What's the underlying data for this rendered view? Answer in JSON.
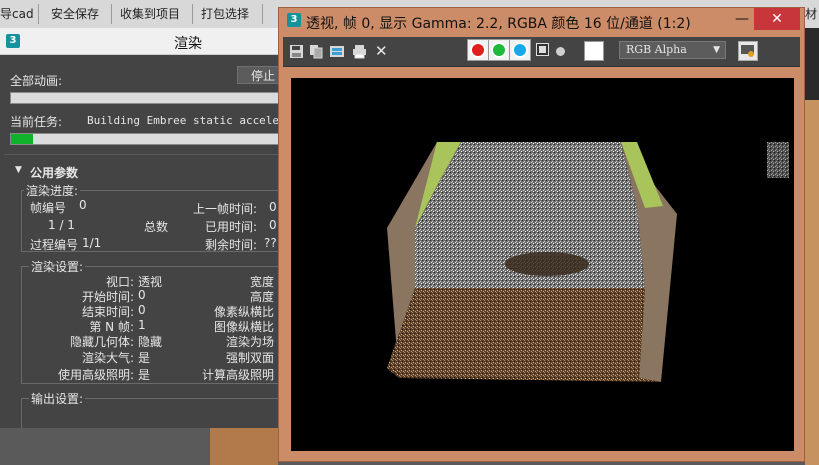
{
  "topbar": {
    "left_fragment": "导cad",
    "items": [
      "安全保存",
      "收集到项目",
      "打包选择"
    ],
    "right_fragment": "材"
  },
  "render_window": {
    "title": "渲染",
    "all_anim_label": "全部动画:",
    "stop_button": "停止",
    "current_task_label": "当前任务:",
    "current_task_value": "Building Embree static accelerator...",
    "task_progress": 0.08,
    "all_anim_progress": 0.0,
    "rollout_title": "公用参数",
    "progress_group": {
      "title": "渲染进度:",
      "frame_no_label": "帧编号",
      "frame_no_value": "0",
      "frames_count": "1 / 1",
      "total_label": "总数",
      "pass_label": "过程编号",
      "pass_value": "1/1",
      "last_frame_label": "上一帧时间:",
      "last_frame_value": "0",
      "elapsed_label": "已用时间:",
      "elapsed_value": "0",
      "remaining_label": "剩余时间:",
      "remaining_value": "??"
    },
    "settings_group": {
      "title": "渲染设置:",
      "rows": [
        {
          "key": "视口:",
          "val": "透视",
          "key2": "宽度"
        },
        {
          "key": "开始时间:",
          "val": "0",
          "key2": "高度"
        },
        {
          "key": "结束时间:",
          "val": "0",
          "key2": "像素纵横比"
        },
        {
          "key": "第 N 帧:",
          "val": "1",
          "key2": "图像纵横比"
        },
        {
          "key": "隐藏几何体:",
          "val": "隐藏",
          "key2": "渲染为场"
        },
        {
          "key": "渲染大气:",
          "val": "是",
          "key2": "强制双面"
        },
        {
          "key": "使用高级照明:",
          "val": "是",
          "key2": "计算高级照明"
        }
      ]
    },
    "output_group_title": "输出设置:"
  },
  "frame_buffer": {
    "title": "透视, 帧 0, 显示 Gamma: 2.2, RGBA 颜色 16 位/通道 (1:2)",
    "channel_select": "RGB Alpha",
    "colors": {
      "red": "#e0201e",
      "green": "#1eb83a",
      "blue": "#1aa8e8"
    }
  }
}
